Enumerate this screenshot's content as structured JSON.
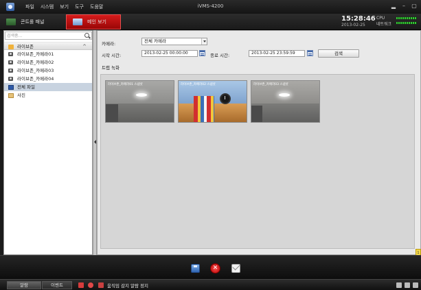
{
  "window": {
    "title": "iVMS-4200",
    "menus": [
      "파일",
      "시스템",
      "보기",
      "도구",
      "도움말"
    ],
    "controls": [
      "▂",
      "–",
      "▢"
    ]
  },
  "tabs": {
    "control_panel": "콘트롤 패널",
    "main_view": "메인 보기"
  },
  "status_clock": {
    "time": "15:28:46",
    "date": "2013-02-25",
    "cpu_label": "CPU",
    "network_label": "네트워크"
  },
  "sidebar": {
    "search_placeholder": "검색중...",
    "group": "라이브존",
    "cameras": [
      "라이브존_카메라01",
      "라이브존_카메라02",
      "라이브존_카메라03",
      "라이브존_카메라04"
    ],
    "all_files": "전체 파일",
    "pictures": "사진"
  },
  "filters": {
    "camera_label": "카메라:",
    "camera_value": "전체 카메라",
    "start_label": "시작 시간:",
    "start_value": "2013-02-25 00:00:00",
    "end_label": "종료 시간:",
    "end_value": "2013-02-25 23:59:59",
    "search_button": "검색"
  },
  "results": {
    "title": "트랩 녹화",
    "thumbnails": [
      {
        "label": "라이브존_카메라01 스냅샷",
        "ceiling": "#9a9a98",
        "floor": "#6e6e6c"
      },
      {
        "label": "라이브존_카메라02 스냅샷",
        "ceiling": "#8fb2d8",
        "floor": "#c58a4a"
      },
      {
        "label": "라이브존_카메라03 스냅샷",
        "ceiling": "#9c9b98",
        "floor": "#717170"
      }
    ]
  },
  "side_marker": "1",
  "toolbar": {
    "save": "save",
    "delete": "✕",
    "mail": "mail"
  },
  "statusbar": {
    "alarm_tab": "알람",
    "event_tab": "이벤트",
    "message": "움직임 감지 알람 정지"
  },
  "colors": {
    "active_tab": "#c20f0f",
    "panel_bg": "#e9e9e9",
    "chrome_bg": "#1b1b1b"
  }
}
